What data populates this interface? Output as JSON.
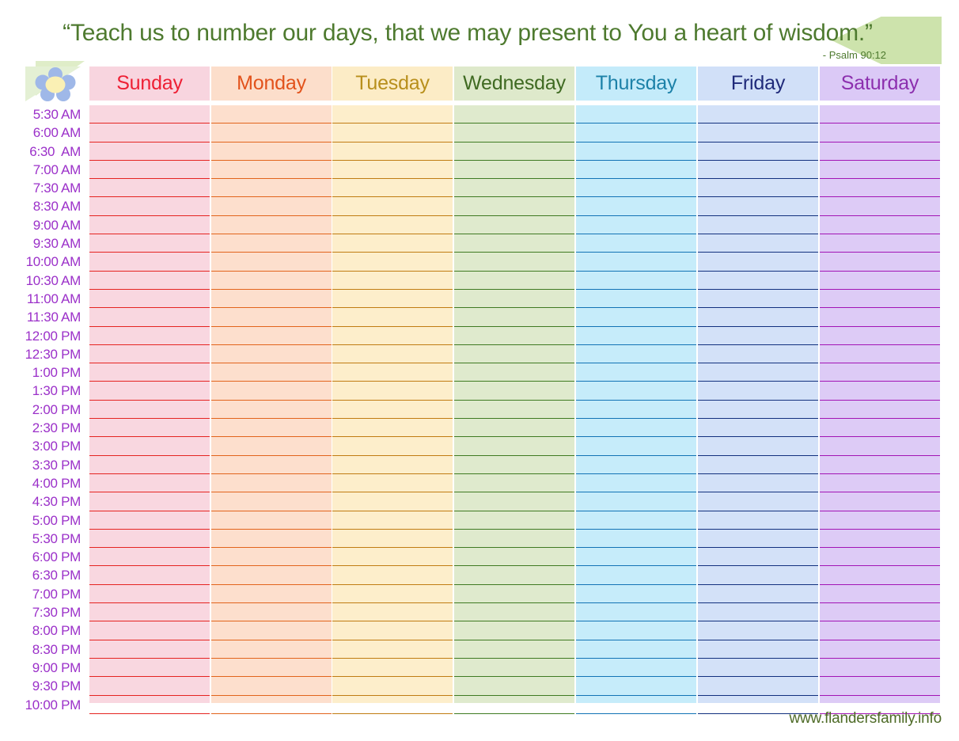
{
  "banner": {
    "quote": "“Teach us to number our days, that we may present to You a heart of wisdom.”",
    "attribution": "- Psalm 90:12",
    "bg_color": "#cde3ac",
    "text_color": "#4e7a2f",
    "tail_color": "#dfedc8"
  },
  "flower": {
    "icon_name": "flower-icon",
    "petal_color": "#9fb8e8",
    "center_color": "#faf0b4",
    "leaf_color": "#e4f0d4"
  },
  "columns": [
    {
      "label": "Sunday",
      "bg": "#f9d7e0",
      "header_bg": "#f8d5df",
      "text": "#ee1f34",
      "line": "#e52421"
    },
    {
      "label": "Monday",
      "bg": "#fddfcd",
      "header_bg": "#fcdecb",
      "text": "#e2521b",
      "line": "#e2641c"
    },
    {
      "label": "Tuesday",
      "bg": "#fdeecb",
      "header_bg": "#fcecc6",
      "text": "#b88f1c",
      "line": "#c07c12"
    },
    {
      "label": "Wednesday",
      "bg": "#dfeacd",
      "header_bg": "#dee9cb",
      "text": "#3f6a22",
      "line": "#3f7a22"
    },
    {
      "label": "Thursday",
      "bg": "#c6ecfa",
      "header_bg": "#c4ebfa",
      "text": "#1c81a8",
      "line": "#1273b5"
    },
    {
      "label": "Friday",
      "bg": "#d3e1f8",
      "header_bg": "#d1e0f8",
      "text": "#1f2a7a",
      "line": "#12307e"
    },
    {
      "label": "Saturday",
      "bg": "#ddcbf6",
      "header_bg": "#dbc9f6",
      "text": "#8c2fae",
      "line": "#a214b5"
    }
  ],
  "times": [
    "5:30 AM",
    "6:00 AM",
    "6:30  AM",
    "7:00 AM",
    "7:30 AM",
    "8:30 AM",
    "9:00 AM",
    "9:30 AM",
    "10:00 AM",
    "10:30 AM",
    "11:00 AM",
    "11:30 AM",
    "12:00 PM",
    "12:30 PM",
    "1:00 PM",
    "1:30 PM",
    "2:00 PM",
    "2:30 PM",
    "3:00 PM",
    "3:30 PM",
    "4:00 PM",
    "4:30 PM",
    "5:00 PM",
    "5:30 PM",
    "6:00 PM",
    "6:30 PM",
    "7:00 PM",
    "7:30 PM",
    "8:00 PM",
    "8:30 PM",
    "9:00 PM",
    "9:30 PM",
    "10:00 PM"
  ],
  "time_label_color": "#9b30c9",
  "footer": {
    "website": "www.flandersfamily.info",
    "color": "#4e6b27"
  }
}
